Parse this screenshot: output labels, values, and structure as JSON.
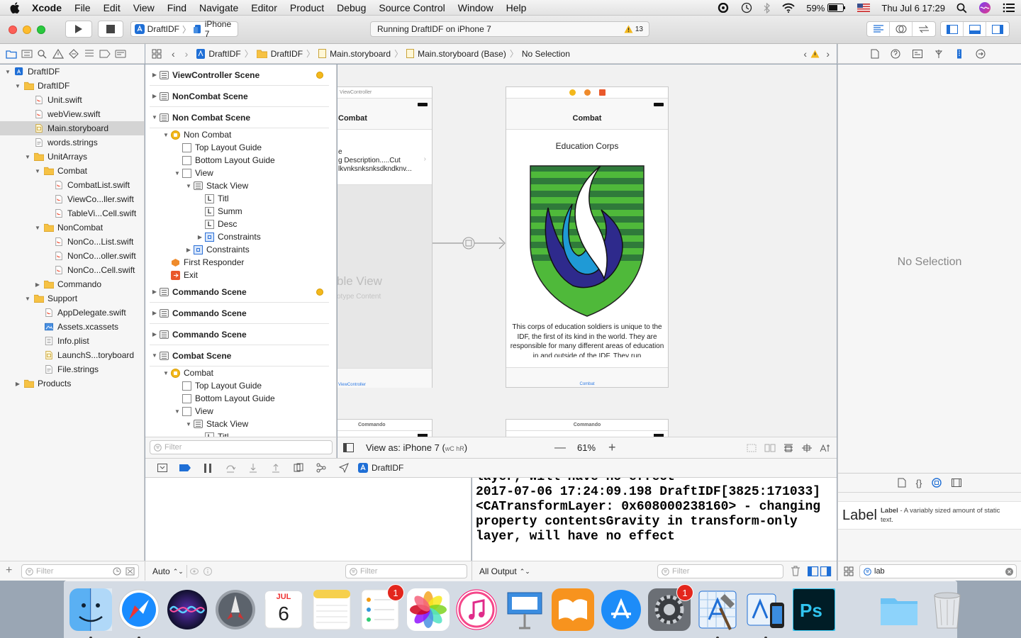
{
  "menubar": {
    "app_name": "Xcode",
    "items": [
      "File",
      "Edit",
      "View",
      "Find",
      "Navigate",
      "Editor",
      "Product",
      "Debug",
      "Source Control",
      "Window",
      "Help"
    ],
    "battery": "59%",
    "datetime": "Thu Jul 6  17:29"
  },
  "toolbar": {
    "scheme_target": "DraftIDF",
    "scheme_device": "iPhone 7",
    "activity": "Running DraftIDF on iPhone 7",
    "warning_count": "13"
  },
  "navigator": {
    "items": [
      {
        "label": "DraftIDF",
        "depth": 0,
        "icon": "project-icon",
        "expanded": true
      },
      {
        "label": "DraftIDF",
        "depth": 1,
        "icon": "folder-icon",
        "expanded": true
      },
      {
        "label": "Unit.swift",
        "depth": 2,
        "icon": "swift-file-icon"
      },
      {
        "label": "webView.swift",
        "depth": 2,
        "icon": "swift-file-icon"
      },
      {
        "label": "Main.storyboard",
        "depth": 2,
        "icon": "storyboard-icon",
        "selected": true
      },
      {
        "label": "words.strings",
        "depth": 2,
        "icon": "strings-file-icon"
      },
      {
        "label": "UnitArrays",
        "depth": 2,
        "icon": "folder-icon",
        "expanded": true
      },
      {
        "label": "Combat",
        "depth": 3,
        "icon": "folder-icon",
        "expanded": true
      },
      {
        "label": "CombatList.swift",
        "depth": 4,
        "icon": "swift-file-icon"
      },
      {
        "label": "ViewCo...ller.swift",
        "depth": 4,
        "icon": "swift-file-icon"
      },
      {
        "label": "TableVi...Cell.swift",
        "depth": 4,
        "icon": "swift-file-icon"
      },
      {
        "label": "NonCombat",
        "depth": 3,
        "icon": "folder-icon",
        "expanded": true
      },
      {
        "label": "NonCo...List.swift",
        "depth": 4,
        "icon": "swift-file-icon"
      },
      {
        "label": "NonCo...oller.swift",
        "depth": 4,
        "icon": "swift-file-icon"
      },
      {
        "label": "NonCo...Cell.swift",
        "depth": 4,
        "icon": "swift-file-icon"
      },
      {
        "label": "Commando",
        "depth": 3,
        "icon": "folder-icon",
        "expanded": false
      },
      {
        "label": "Support",
        "depth": 2,
        "icon": "folder-icon",
        "expanded": true
      },
      {
        "label": "AppDelegate.swift",
        "depth": 3,
        "icon": "swift-file-icon"
      },
      {
        "label": "Assets.xcassets",
        "depth": 3,
        "icon": "assets-icon"
      },
      {
        "label": "Info.plist",
        "depth": 3,
        "icon": "plist-icon"
      },
      {
        "label": "LaunchS...toryboard",
        "depth": 3,
        "icon": "storyboard-icon"
      },
      {
        "label": "File.strings",
        "depth": 3,
        "icon": "strings-file-icon"
      },
      {
        "label": "Products",
        "depth": 1,
        "icon": "folder-icon",
        "expanded": false
      }
    ],
    "filter_placeholder": "Filter"
  },
  "jumpbar": {
    "crumbs": [
      "DraftIDF",
      "DraftIDF",
      "Main.storyboard",
      "Main.storyboard (Base)",
      "No Selection"
    ]
  },
  "outline": {
    "rows": [
      {
        "label": "ViewController Scene",
        "kind": "scene",
        "depth": 0,
        "expanded": false,
        "badge": true
      },
      {
        "label": "NonCombat Scene",
        "kind": "scene",
        "depth": 0,
        "expanded": false
      },
      {
        "label": "Non Combat Scene",
        "kind": "scene",
        "depth": 0,
        "expanded": true
      },
      {
        "label": "Non Combat",
        "kind": "controller",
        "depth": 1,
        "expanded": true
      },
      {
        "label": "Top Layout Guide",
        "kind": "view",
        "depth": 2
      },
      {
        "label": "Bottom Layout Guide",
        "kind": "view",
        "depth": 2
      },
      {
        "label": "View",
        "kind": "view",
        "depth": 2,
        "expanded": true
      },
      {
        "label": "Stack View",
        "kind": "stack",
        "depth": 3,
        "expanded": true
      },
      {
        "label": "Titl",
        "kind": "label",
        "depth": 4
      },
      {
        "label": "Summ",
        "kind": "label",
        "depth": 4
      },
      {
        "label": "Desc",
        "kind": "label",
        "depth": 4
      },
      {
        "label": "Constraints",
        "kind": "constraints",
        "depth": 4,
        "expanded": false
      },
      {
        "label": "Constraints",
        "kind": "constraints",
        "depth": 3,
        "expanded": false
      },
      {
        "label": "First Responder",
        "kind": "responder",
        "depth": 1
      },
      {
        "label": "Exit",
        "kind": "exit",
        "depth": 1
      },
      {
        "label": "Commando Scene",
        "kind": "scene",
        "depth": 0,
        "expanded": false,
        "badge": true
      },
      {
        "label": "Commando Scene",
        "kind": "scene",
        "depth": 0,
        "expanded": false
      },
      {
        "label": "Commando Scene",
        "kind": "scene",
        "depth": 0,
        "expanded": false
      },
      {
        "label": "Combat Scene",
        "kind": "scene",
        "depth": 0,
        "expanded": true
      },
      {
        "label": "Combat",
        "kind": "controller",
        "depth": 1,
        "expanded": true
      },
      {
        "label": "Top Layout Guide",
        "kind": "view",
        "depth": 2
      },
      {
        "label": "Bottom Layout Guide",
        "kind": "view",
        "depth": 2
      },
      {
        "label": "View",
        "kind": "view",
        "depth": 2,
        "expanded": true
      },
      {
        "label": "Stack View",
        "kind": "stack",
        "depth": 3,
        "expanded": true
      },
      {
        "label": "Titl",
        "kind": "label",
        "depth": 4
      }
    ],
    "filter_placeholder": "Filter"
  },
  "canvas": {
    "left_scene": {
      "header": "ViewController",
      "nav_title": "Combat",
      "cell_line1": "e",
      "cell_line2": "g Description.....Cut",
      "cell_line3": "lkvnksnksnksdkndknv...",
      "table_title": "ble View",
      "table_sub": "otype Content",
      "tab_label": "ViewController"
    },
    "right_scene": {
      "nav_title": "Combat",
      "title": "Education Corps",
      "description": "This corps of education soldiers is unique to the IDF, the first of its kind in the world. They are responsible for many different areas of education in and outside of the IDF. They run",
      "tab_label": "Combat"
    },
    "bottom_left_header": "Commando",
    "bottom_right_header": "Commando",
    "view_as": "View as: iPhone 7 (",
    "view_as_size": "wC hR",
    "view_as_end": ")",
    "zoom": "61%"
  },
  "debug": {
    "target": "DraftIDF",
    "console_lines": [
      "layer, will have no effect",
      "2017-07-06 17:24:09.198 DraftIDF[3825:171033]",
      "<CATransformLayer: 0x608000238160> - changing",
      "property contentsGravity in transform-only",
      "layer, will have no effect"
    ],
    "auto_label": "Auto",
    "filter_placeholder": "Filter",
    "output_label": "All Output",
    "console_filter_placeholder": "Filter"
  },
  "inspector": {
    "empty_text": "No Selection"
  },
  "library": {
    "item_preview": "Label",
    "item_name": "Label",
    "item_desc": " - A variably sized amount of static text.",
    "search_value": "lab"
  },
  "dock": {
    "apps": [
      {
        "name": "finder",
        "running": true
      },
      {
        "name": "safari",
        "running": true
      },
      {
        "name": "siri"
      },
      {
        "name": "launchpad"
      },
      {
        "name": "calendar",
        "month": "JUL",
        "day": "6"
      },
      {
        "name": "notes"
      },
      {
        "name": "reminders",
        "badge": "1"
      },
      {
        "name": "photos"
      },
      {
        "name": "itunes"
      },
      {
        "name": "keynote"
      },
      {
        "name": "ibooks"
      },
      {
        "name": "app-store"
      },
      {
        "name": "system-preferences",
        "badge": "1"
      },
      {
        "name": "xcode",
        "running": true
      },
      {
        "name": "simulator",
        "running": true
      },
      {
        "name": "photoshop"
      },
      {
        "name": "downloads-folder"
      },
      {
        "name": "trash"
      }
    ]
  },
  "colors": {
    "accent": "#1f6fd6",
    "warning": "#f3b81c",
    "selection": "#d4d4d4"
  }
}
